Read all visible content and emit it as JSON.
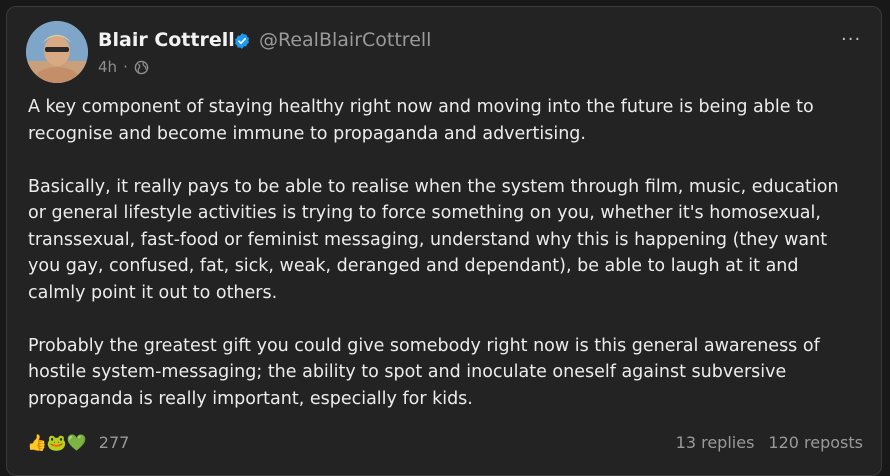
{
  "post": {
    "author_name": "Blair Cottrell",
    "author_handle": "@RealBlairCottrell",
    "time_ago": "4h",
    "separator": "·",
    "more_label": "···",
    "paragraphs": [
      "A key component of staying healthy right now and moving into the future is being able to recognise and become immune to propaganda and advertising.",
      "Basically, it really pays to be able to realise when the system through film, music, education or general lifestyle activities is trying to force something on you, whether it's homosexual, transsexual, fast-food or feminist messaging, understand why this is happening (they want you gay, confused, fat, sick, weak, deranged and dependant), be able to laugh at it and calmly point it out to others.",
      "Probably the greatest gift you could give somebody right now is this general awareness of hostile system-messaging; the ability to spot and inoculate oneself against subversive propaganda is really important, especially for kids."
    ],
    "reactions": {
      "icons": [
        "thumbs-up-icon",
        "frog-icon",
        "green-heart-icon"
      ],
      "glyphs": [
        "👍",
        "🐸",
        "💚"
      ],
      "count": "277"
    },
    "replies_label": "13 replies",
    "reposts_label": "120 reposts"
  },
  "colors": {
    "card_bg": "#232323",
    "page_bg": "#181818",
    "verified": "#1d9bf0",
    "muted_text": "#9a9a9a"
  }
}
